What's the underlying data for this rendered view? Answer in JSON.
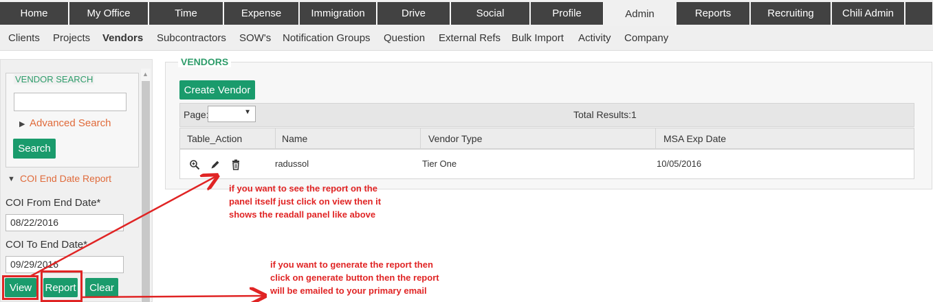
{
  "topnav": [
    "Home",
    "My Office",
    "Time",
    "Expense",
    "Immigration",
    "Drive",
    "Social",
    "Profile",
    "Admin",
    "Reports",
    "Recruiting",
    "Chili Admin"
  ],
  "active_topnav": "Admin",
  "subnav": [
    "Clients",
    "Projects",
    "Vendors",
    "Subcontractors",
    "SOW's",
    "Notification Groups",
    "Question",
    "External Refs",
    "Bulk Import",
    "Activity",
    "Company"
  ],
  "active_subnav": "Vendors",
  "left": {
    "vendor_search_legend": "VENDOR SEARCH",
    "search_value": "",
    "advanced_search": "Advanced Search",
    "search_button": "Search",
    "coi_report": "COI End Date Report",
    "from_label": "COI From End Date*",
    "from_value": "08/22/2016",
    "to_label": "COI To End Date*",
    "to_value": "09/29/2016",
    "view_button": "View",
    "report_button": "Report",
    "clear_button": "Clear"
  },
  "main": {
    "legend": "VENDORS",
    "create_button": "Create Vendor",
    "page_label": "Page:",
    "page_value": "",
    "total_results": "Total Results:1",
    "columns": [
      "Table_Action",
      "Name",
      "Vendor Type",
      "MSA Exp Date"
    ],
    "rows": [
      {
        "name": "radussol",
        "vendor_type": "Tier One",
        "msa_exp_date": "10/05/2016"
      }
    ]
  },
  "annotations": {
    "note1": "if you want to see the report on the\npanel itself just click on view then it\nshows the readall panel like above",
    "note2": "if you want to generate the report then\nclick on generate button then the report\nwill be emailed to your primary email"
  },
  "colors": {
    "accent": "#1a9b6c",
    "nav": "#424242",
    "annotation": "#e02424",
    "link": "#e06a3a"
  }
}
